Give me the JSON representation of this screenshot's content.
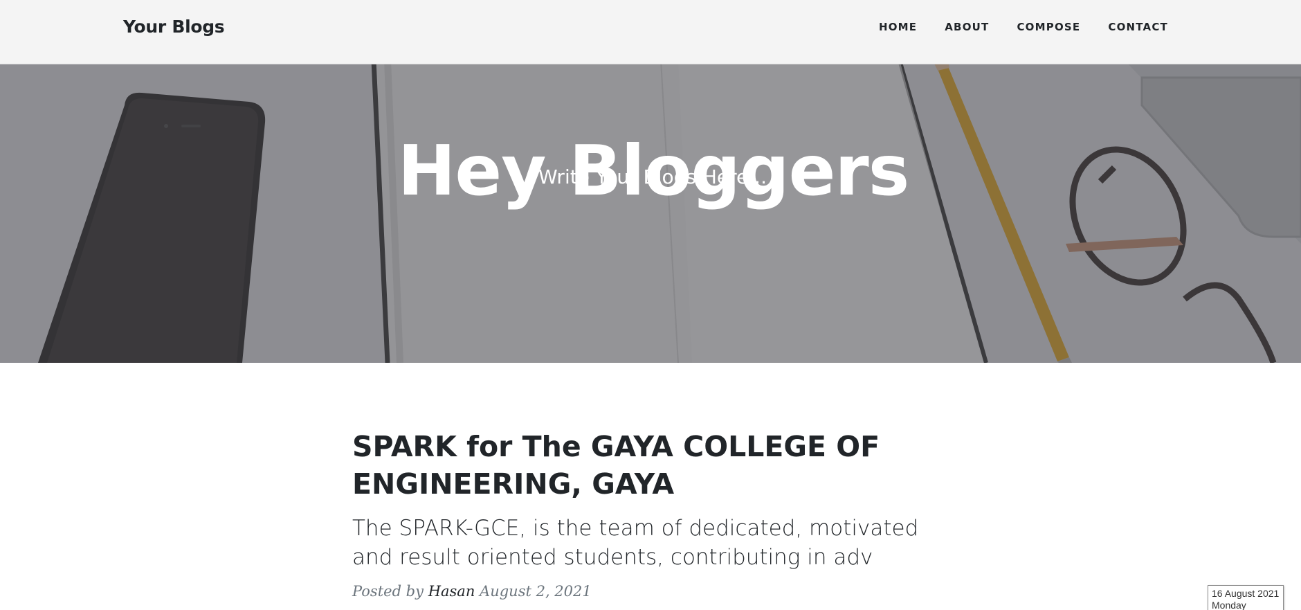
{
  "navbar": {
    "brand": "Your Blogs",
    "links": [
      {
        "label": "HOME"
      },
      {
        "label": "ABOUT"
      },
      {
        "label": "COMPOSE"
      },
      {
        "label": "CONTACT"
      }
    ]
  },
  "masthead": {
    "title": "Hey Bloggers",
    "subtitle": "Write Your Blogs Here..."
  },
  "post": {
    "title": "SPARK for The GAYA COLLEGE OF ENGINEERING, GAYA",
    "subtitle": "The SPARK-GCE, is the team of dedicated, motivated and result oriented students, contributing in adv",
    "meta_prefix": "Posted by",
    "author": "Hasan",
    "date": "August 2, 2021"
  },
  "date_widget": {
    "date": "16 August 2021",
    "day": "Monday"
  },
  "colors": {
    "text": "#212529",
    "muted": "#6c757d",
    "navbar_bg": "#f4f4f4",
    "hero_text": "#ffffff"
  }
}
